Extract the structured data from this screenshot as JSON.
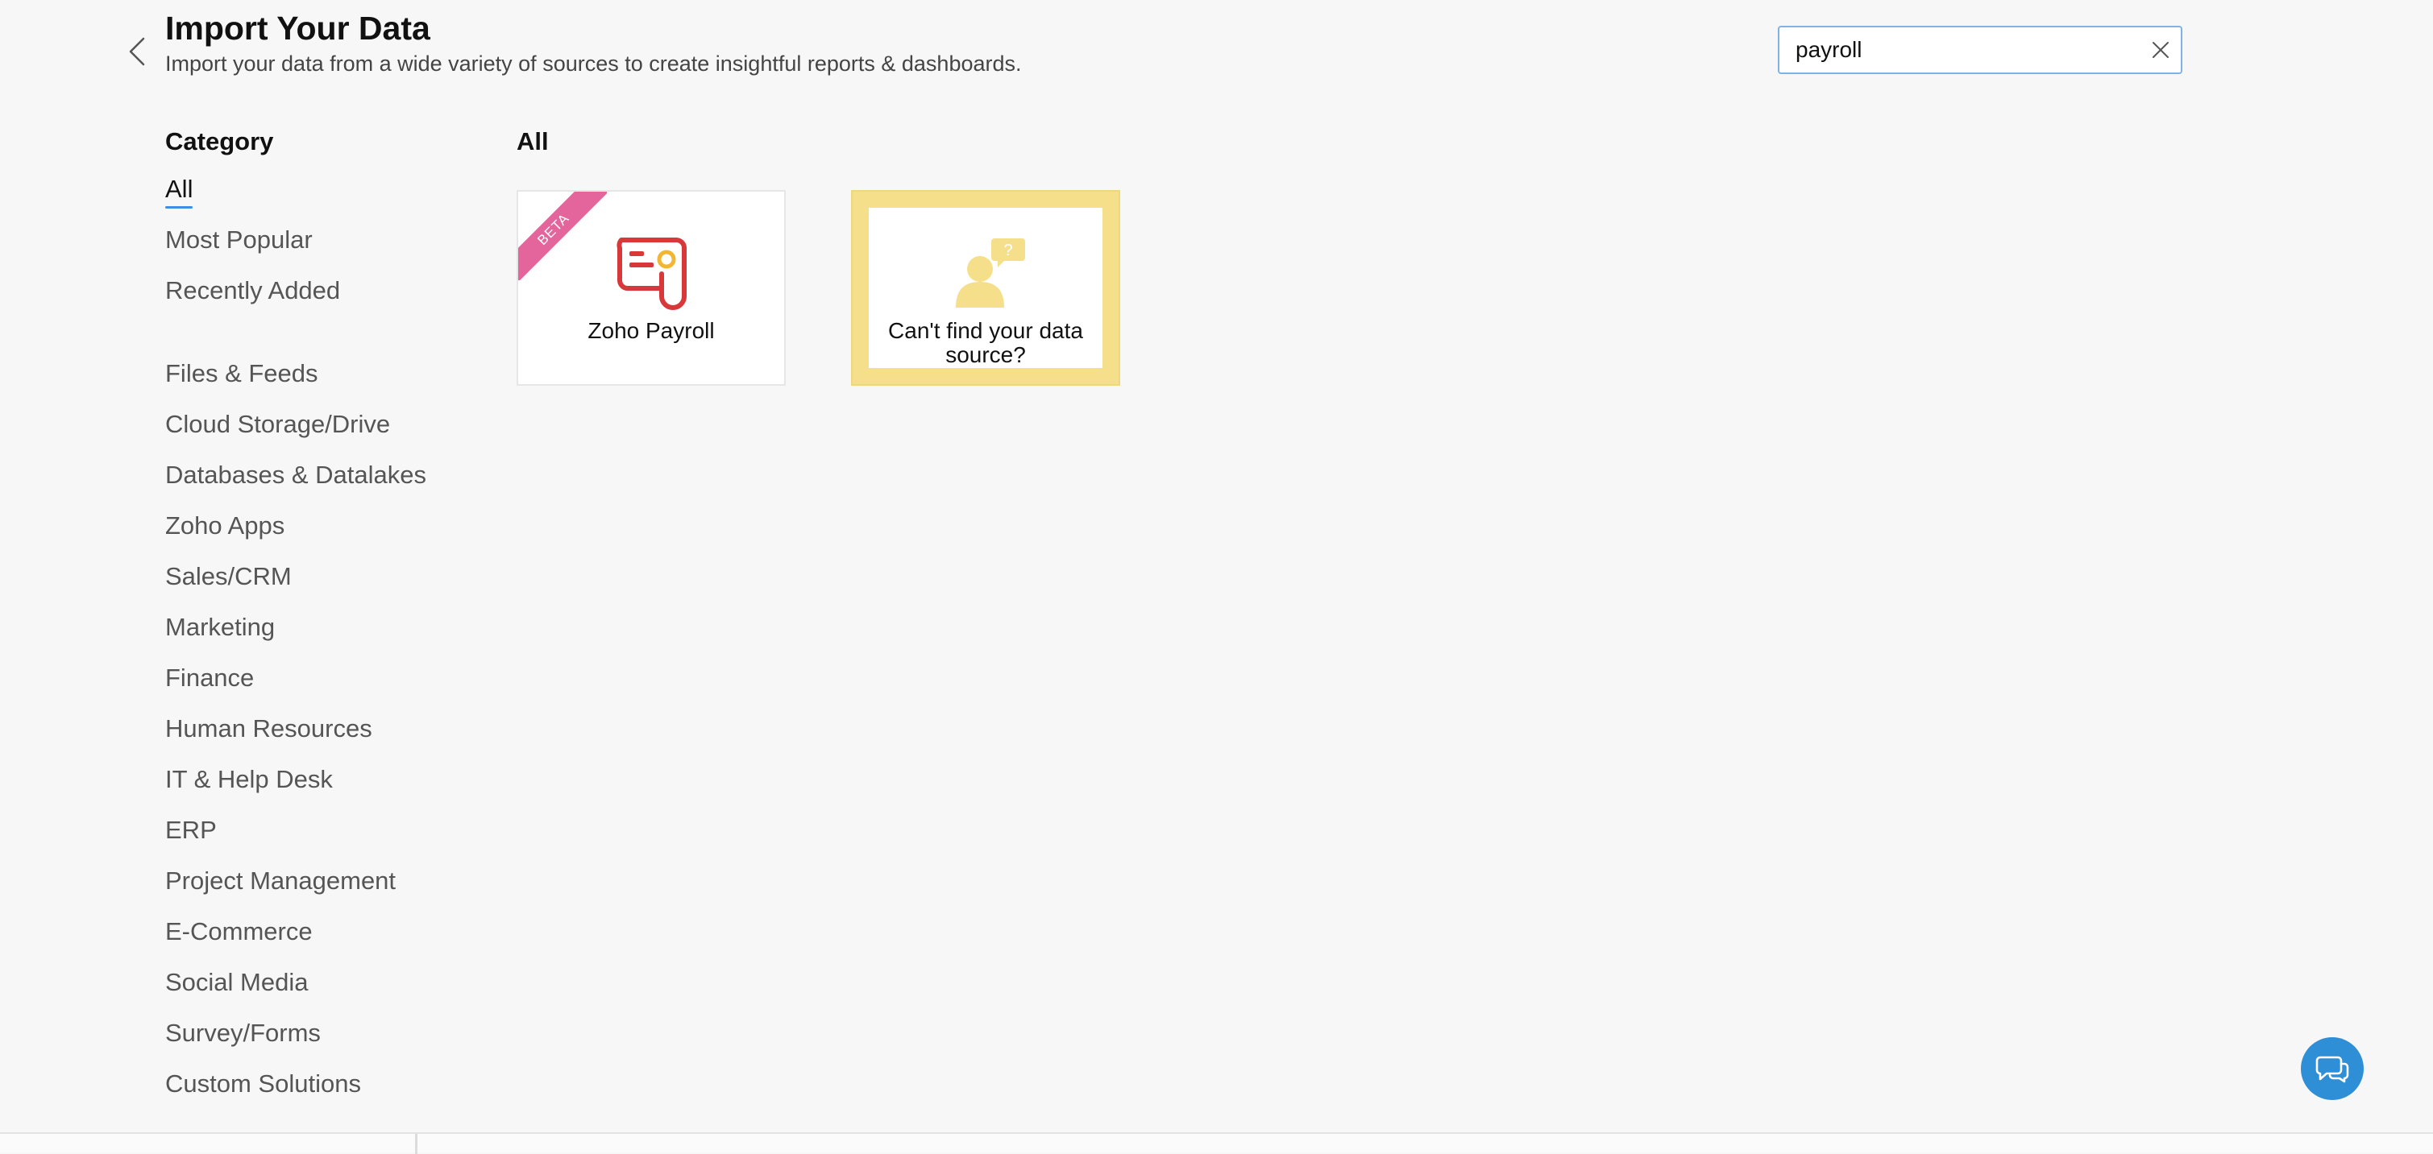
{
  "header": {
    "title": "Import Your Data",
    "subtitle": "Import your data from a wide variety of sources to create insightful reports & dashboards."
  },
  "search": {
    "value": "payroll"
  },
  "sidebar": {
    "heading": "Category",
    "items": [
      {
        "label": "All",
        "active": true
      },
      {
        "label": "Most Popular"
      },
      {
        "label": "Recently Added"
      },
      {
        "label": "Files & Feeds"
      },
      {
        "label": "Cloud Storage/Drive"
      },
      {
        "label": "Databases & Datalakes"
      },
      {
        "label": "Zoho Apps"
      },
      {
        "label": "Sales/CRM"
      },
      {
        "label": "Marketing"
      },
      {
        "label": "Finance"
      },
      {
        "label": "Human Resources"
      },
      {
        "label": "IT & Help Desk"
      },
      {
        "label": "ERP"
      },
      {
        "label": "Project Management"
      },
      {
        "label": "E-Commerce"
      },
      {
        "label": "Social Media"
      },
      {
        "label": "Survey/Forms"
      },
      {
        "label": "Custom Solutions"
      }
    ]
  },
  "main": {
    "heading": "All",
    "cards": [
      {
        "label": "Zoho Payroll",
        "badge": "BETA",
        "icon": "payroll-icon"
      },
      {
        "label_line1": "Can't find your data",
        "label_line2": "source?",
        "icon": "person-question-icon"
      }
    ]
  },
  "colors": {
    "accent": "#3d8ee6",
    "beta_ribbon": "#e4649c",
    "help_card": "#f6df8a",
    "payroll_red": "#d9383a",
    "payroll_yellow": "#f2b632",
    "chat_button": "#2e8fd6"
  }
}
